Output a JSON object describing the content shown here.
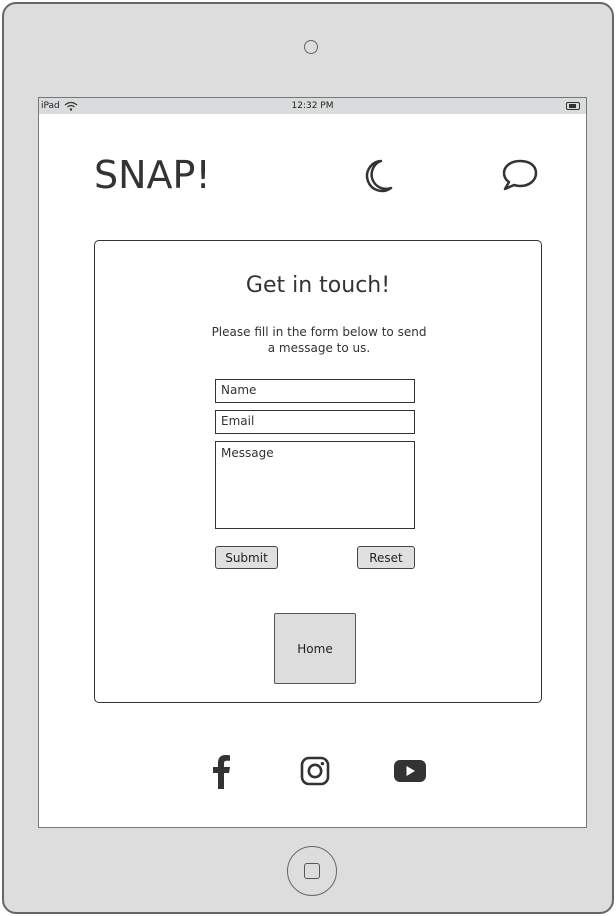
{
  "statusbar": {
    "device": "iPad",
    "time": "12:32 PM"
  },
  "header": {
    "logo": "SNAP!",
    "icons": [
      "moon-icon",
      "chat-icon"
    ]
  },
  "contact": {
    "title": "Get in touch!",
    "description": "Please fill in the form below to send a message to us.",
    "name_placeholder": "Name",
    "email_placeholder": "Email",
    "message_placeholder": "Message",
    "submit_label": "Submit",
    "reset_label": "Reset",
    "home_label": "Home"
  },
  "footer": {
    "icons": [
      "facebook-icon",
      "instagram-icon",
      "youtube-icon"
    ]
  },
  "colors": {
    "frame": "#dddddd",
    "text": "#333333",
    "button": "#e0e0e0"
  }
}
